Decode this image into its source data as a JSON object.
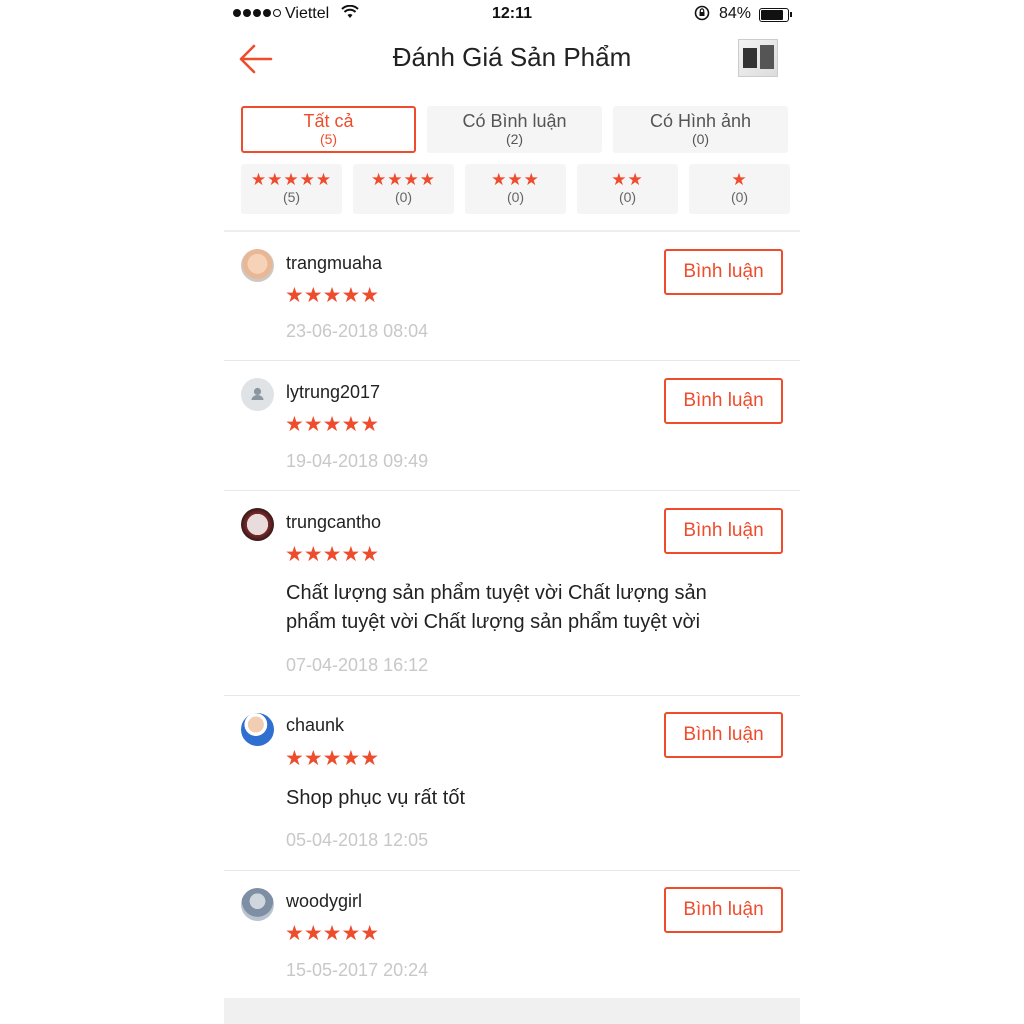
{
  "status_bar": {
    "carrier": "Viettel",
    "time": "12:11",
    "battery": "84%"
  },
  "header": {
    "title": "Đánh Giá Sản Phẩm"
  },
  "filters": {
    "all": {
      "label": "Tất cả",
      "count": "(5)"
    },
    "with_comment": {
      "label": "Có Bình luận",
      "count": "(2)"
    },
    "with_image": {
      "label": "Có Hình ảnh",
      "count": "(0)"
    },
    "stars": [
      {
        "stars": "★★★★★",
        "count": "(5)"
      },
      {
        "stars": "★★★★",
        "count": "(0)"
      },
      {
        "stars": "★★★",
        "count": "(0)"
      },
      {
        "stars": "★★",
        "count": "(0)"
      },
      {
        "stars": "★",
        "count": "(0)"
      }
    ]
  },
  "comment_button_label": "Bình luận",
  "accent_color": "#ee4d2d",
  "reviews": [
    {
      "user": "trangmuaha",
      "stars": "★★★★★",
      "rating": 5,
      "text": "",
      "date": "23-06-2018 08:04"
    },
    {
      "user": "lytrung2017",
      "stars": "★★★★★",
      "rating": 5,
      "text": "",
      "date": "19-04-2018 09:49"
    },
    {
      "user": "trungcantho",
      "stars": "★★★★★",
      "rating": 5,
      "text": "Chất lượng sản phẩm tuyệt vời Chất lượng sản phẩm tuyệt vời Chất lượng sản phẩm tuyệt vời",
      "date": "07-04-2018 16:12"
    },
    {
      "user": "chaunk",
      "stars": "★★★★★",
      "rating": 5,
      "text": "Shop phục vụ rất tốt",
      "date": "05-04-2018 12:05"
    },
    {
      "user": "woodygirl",
      "stars": "★★★★★",
      "rating": 5,
      "text": "",
      "date": "15-05-2017 20:24"
    }
  ]
}
